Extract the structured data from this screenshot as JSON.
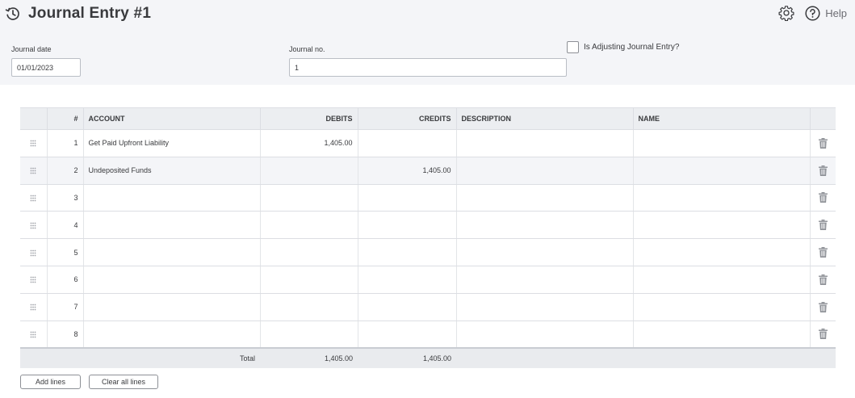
{
  "header": {
    "title": "Journal Entry #1",
    "help_label": "Help"
  },
  "form": {
    "journal_date_label": "Journal date",
    "journal_date_value": "01/01/2023",
    "journal_no_label": "Journal no.",
    "journal_no_value": "1",
    "adjusting_label": "Is Adjusting Journal Entry?",
    "adjusting_checked": false
  },
  "table": {
    "headers": {
      "num": "#",
      "account": "ACCOUNT",
      "debits": "DEBITS",
      "credits": "CREDITS",
      "description": "DESCRIPTION",
      "name": "NAME"
    },
    "rows": [
      {
        "num": "1",
        "account": "Get Paid Upfront Liability",
        "debits": "1,405.00",
        "credits": "",
        "description": "",
        "name": ""
      },
      {
        "num": "2",
        "account": "Undeposited Funds",
        "debits": "",
        "credits": "1,405.00",
        "description": "",
        "name": ""
      },
      {
        "num": "3",
        "account": "",
        "debits": "",
        "credits": "",
        "description": "",
        "name": ""
      },
      {
        "num": "4",
        "account": "",
        "debits": "",
        "credits": "",
        "description": "",
        "name": ""
      },
      {
        "num": "5",
        "account": "",
        "debits": "",
        "credits": "",
        "description": "",
        "name": ""
      },
      {
        "num": "6",
        "account": "",
        "debits": "",
        "credits": "",
        "description": "",
        "name": ""
      },
      {
        "num": "7",
        "account": "",
        "debits": "",
        "credits": "",
        "description": "",
        "name": ""
      },
      {
        "num": "8",
        "account": "",
        "debits": "",
        "credits": "",
        "description": "",
        "name": ""
      }
    ],
    "total": {
      "label": "Total",
      "debits": "1,405.00",
      "credits": "1,405.00"
    }
  },
  "actions": {
    "add_lines": "Add lines",
    "clear_all_lines": "Clear all lines"
  },
  "icons": {
    "history": "history-clock-icon",
    "settings": "gear-icon",
    "help": "help-circle-icon",
    "drag": "drag-handle-icon",
    "delete": "trash-icon"
  }
}
